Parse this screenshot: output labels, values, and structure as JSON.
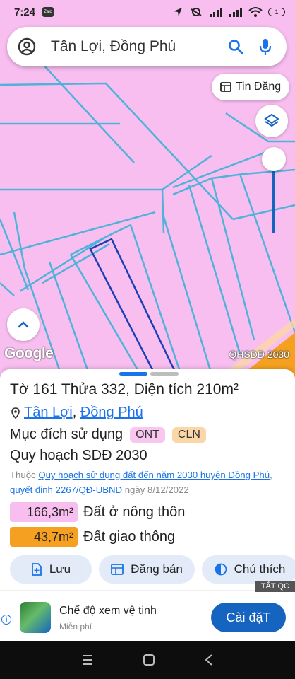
{
  "status_bar": {
    "time": "7:24",
    "app_badge": "Zalo",
    "battery_level": "1"
  },
  "search": {
    "query": "Tân Lợi, Đồng Phú"
  },
  "map": {
    "post_button_label": "Tin Đăng",
    "google_logo": "Google",
    "layer_tag": "QHSDĐ 2030",
    "colors": {
      "land": "#f8bef0",
      "parcel_lines": "#4fb3d9",
      "selected_parcel": "#1a3fb5",
      "road": "#f5a020"
    }
  },
  "parcel": {
    "title": "Tờ 161 Thửa 332, Diện tích 210m²",
    "location_parts": [
      "Tân Lợi",
      "Đồng Phú"
    ],
    "location_separator": ", ",
    "purpose_label": "Mục đích sử dụng",
    "purpose_codes": [
      {
        "code": "ONT",
        "color": "#f9c6f0"
      },
      {
        "code": "CLN",
        "color": "#fbd7a8"
      }
    ],
    "plan_label": "Quy hoạch SDĐ 2030",
    "source_prefix": "Thuộc ",
    "source_link": "Quy hoạch sử dụng đất đến năm 2030 huyện Đồng Phú",
    "source_sep": ", ",
    "decision_link": "quyết định 2267/QĐ-UBND",
    "date_text": " ngày 8/12/2022",
    "areas": [
      {
        "value": "166,3m²",
        "label": "Đất ở nông thôn",
        "color": "#f8bef0"
      },
      {
        "value": "43,7m²",
        "label": "Đất giao thông",
        "color": "#f5a020"
      }
    ]
  },
  "actions": {
    "save": "Lưu",
    "post": "Đăng bán",
    "legend": "Chú thích"
  },
  "ad": {
    "hide_label": "TẮT QC",
    "app_name": "Chế độ xem vệ tinh",
    "subtitle": "Miễn phí",
    "install": "Cài đặT"
  },
  "colors": {
    "accent": "#1565c0",
    "link": "#1a73e8",
    "action_bg": "#e3ebf8",
    "handle_active": "#1a73e8",
    "handle_inactive": "#bdbdbd"
  }
}
